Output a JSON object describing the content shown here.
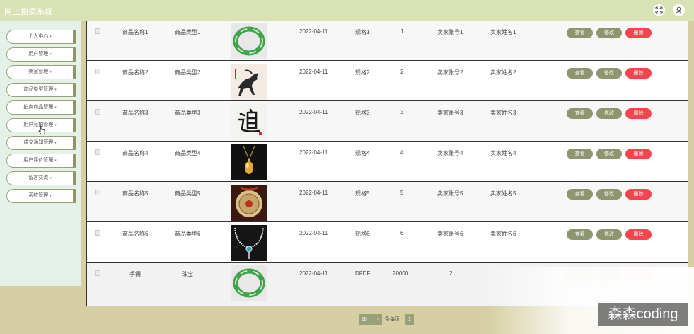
{
  "app": {
    "title": "网上拍卖系统"
  },
  "header_icons": [
    "expand-icon",
    "user-icon"
  ],
  "sidebar": {
    "items": [
      {
        "label": "个人中心"
      },
      {
        "label": "用户管理"
      },
      {
        "label": "卖家管理"
      },
      {
        "label": "商品类型管理"
      },
      {
        "label": "拍卖商品管理"
      },
      {
        "label": "用户竞拍管理"
      },
      {
        "label": "成交通知管理"
      },
      {
        "label": "用户评价管理"
      },
      {
        "label": "留言交流"
      },
      {
        "label": "系统管理"
      }
    ]
  },
  "actions": {
    "view": "查看",
    "edit": "修改",
    "delete": "删除"
  },
  "rows": [
    {
      "name": "商品名称1",
      "type": "商品类型1",
      "image": "jade-bracelet",
      "date": "2022-04-11",
      "spec": "规格1",
      "num": "1",
      "seller_account": "卖家账号1",
      "seller_name": "卖家姓名1"
    },
    {
      "name": "商品名称2",
      "type": "商品类型2",
      "image": "horse-painting",
      "date": "2022-04-11",
      "spec": "规格2",
      "num": "2",
      "seller_account": "卖家账号2",
      "seller_name": "卖家姓名2"
    },
    {
      "name": "商品名称3",
      "type": "商品类型3",
      "image": "calligraphy",
      "date": "2022-04-11",
      "spec": "规格3",
      "num": "3",
      "seller_account": "卖家账号3",
      "seller_name": "卖家姓名3"
    },
    {
      "name": "商品名称4",
      "type": "商品类型4",
      "image": "amber-pendant",
      "date": "2022-04-11",
      "spec": "规格4",
      "num": "4",
      "seller_account": "卖家账号4",
      "seller_name": "卖家姓名4"
    },
    {
      "name": "商品名称5",
      "type": "商品类型5",
      "image": "jade-disc",
      "date": "2022-04-11",
      "spec": "规格5",
      "num": "5",
      "seller_account": "卖家账号5",
      "seller_name": "卖家姓名5"
    },
    {
      "name": "商品名称6",
      "type": "商品类型6",
      "image": "necklace",
      "date": "2022-04-11",
      "spec": "规格6",
      "num": "6",
      "seller_account": "卖家账号6",
      "seller_name": "卖家姓名6"
    }
  ],
  "last_row": {
    "name": "手镯",
    "type": "珠宝",
    "image": "jade-bracelet",
    "date": "2022-04-11",
    "spec": "DFDF",
    "num": "20000",
    "extra": "2"
  },
  "pagination": {
    "page_size": "10",
    "per_page_label": "条每页",
    "current_page": "1"
  },
  "watermark": "森森coding",
  "colors": {
    "topbar": "#d9e2b4",
    "sidebar": "#e3f1e9",
    "accent": "#8e9670",
    "delete": "#f4454f",
    "background": "#d6cfa3"
  }
}
